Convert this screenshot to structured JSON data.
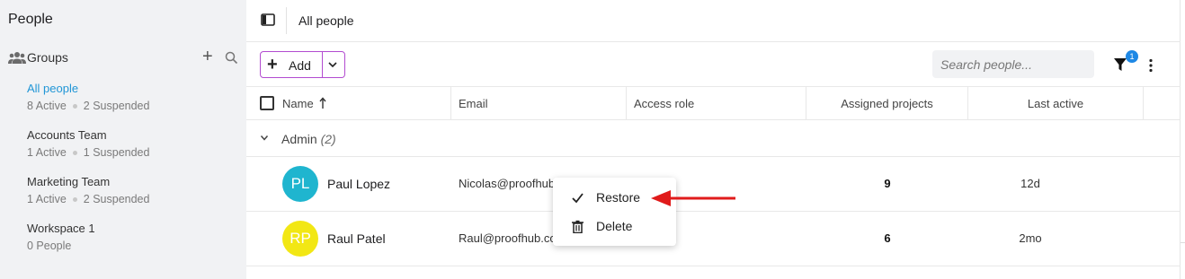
{
  "sidebar": {
    "title": "People",
    "groups_label": "Groups",
    "groups": [
      {
        "name": "All people",
        "active_count": "8 Active",
        "suspended_count": "2 Suspended",
        "selected": true
      },
      {
        "name": "Accounts Team",
        "active_count": "1 Active",
        "suspended_count": "1 Suspended",
        "selected": false
      },
      {
        "name": "Marketing Team",
        "active_count": "1 Active",
        "suspended_count": "2 Suspended",
        "selected": false
      },
      {
        "name": "Workspace 1",
        "people_count": "0 People",
        "selected": false
      }
    ]
  },
  "header": {
    "title": "All people"
  },
  "toolbar": {
    "add_label": "Add",
    "add_icon": "plus-icon",
    "search_placeholder": "Search people...",
    "filter_badge": "1"
  },
  "table": {
    "columns": [
      "Name",
      "Email",
      "Access role",
      "Assigned projects",
      "Last active"
    ],
    "sort_indicator": "arrow-up-icon",
    "group": {
      "name": "Admin",
      "count": "(2)"
    },
    "rows": [
      {
        "initials": "PL",
        "name": "Paul Lopez",
        "email": "Nicolas@proofhub.com",
        "projects": "9",
        "last_active": "12d",
        "avatar_color": "#1fb5cf"
      },
      {
        "initials": "RP",
        "name": "Raul Patel",
        "email": "Raul@proofhub.com",
        "projects": "6",
        "last_active": "2mo",
        "avatar_color": "#f2e714"
      }
    ]
  },
  "context_menu": {
    "items": [
      {
        "label": "Restore",
        "icon": "check-icon"
      },
      {
        "label": "Delete",
        "icon": "trash-icon"
      }
    ]
  },
  "colors": {
    "accent": "#2196d6",
    "add_border": "#b24bd0",
    "badge": "#1e88e5",
    "annotation_arrow": "#e01b1b"
  }
}
